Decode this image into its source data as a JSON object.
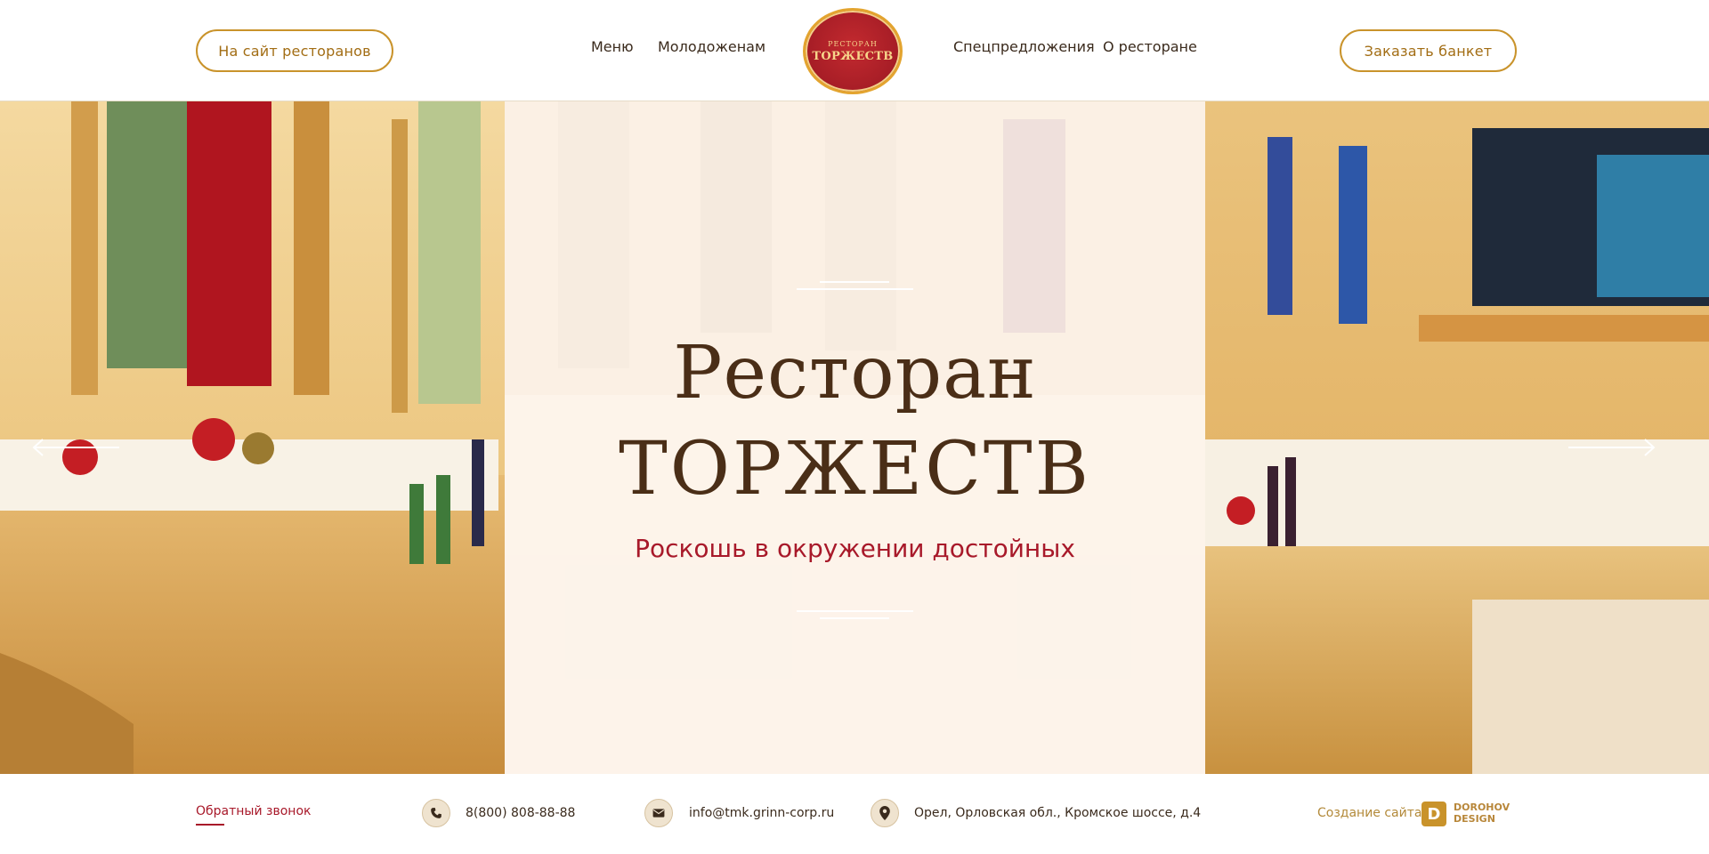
{
  "header": {
    "left_button": "На сайт ресторанов",
    "right_button": "Заказать банкет",
    "nav": [
      "Меню",
      "Молодоженам",
      "Спецпредложения",
      "О ресторане"
    ],
    "logo_top": "РЕСТОРАН",
    "logo_main": "ТОРЖЕСТВ"
  },
  "hero": {
    "title_line1": "Ресторан",
    "title_line2": "ТОРЖЕСТВ",
    "subtitle": "Роскошь в окружении достойных",
    "arrow_left_icon": "arrow-left-icon",
    "arrow_right_icon": "arrow-right-icon"
  },
  "footer": {
    "callback": "Обратный звонок",
    "phone": "8(800) 808-88-88",
    "email": "info@tmk.grinn-corp.ru",
    "address": "Орел, Орловская обл., Кромское шоссе, д.4",
    "created_by": "Создание сайта -",
    "designer_line1": "DOROHOV",
    "designer_line2": "DESIGN",
    "designer_mark": "D"
  },
  "colors": {
    "accent_gold": "#c9932b",
    "brand_red": "#a8192a",
    "title_brown": "#4a2e17"
  }
}
